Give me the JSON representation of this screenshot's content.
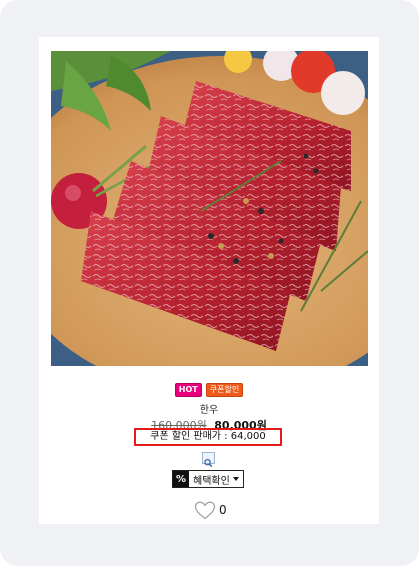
{
  "product": {
    "image_alt": "Sliced raw beef on wooden board",
    "badges": {
      "hot": "HOT",
      "coupon": "쿠폰할인"
    },
    "name": "한우",
    "original_price": "160,000원",
    "sale_price": "80,000원",
    "coupon_price_text": "쿠폰 할인 판매가 : 64,000",
    "benefit": {
      "icon_text": "%",
      "label": "혜택확인"
    },
    "like_count": "0"
  },
  "colors": {
    "hot_badge": "#e8007d",
    "coupon_badge": "#ef5a1a",
    "coupon_box_border": "#e21b1b"
  },
  "icons": [
    "zoom-icon",
    "heart-icon",
    "caret-down-icon"
  ]
}
